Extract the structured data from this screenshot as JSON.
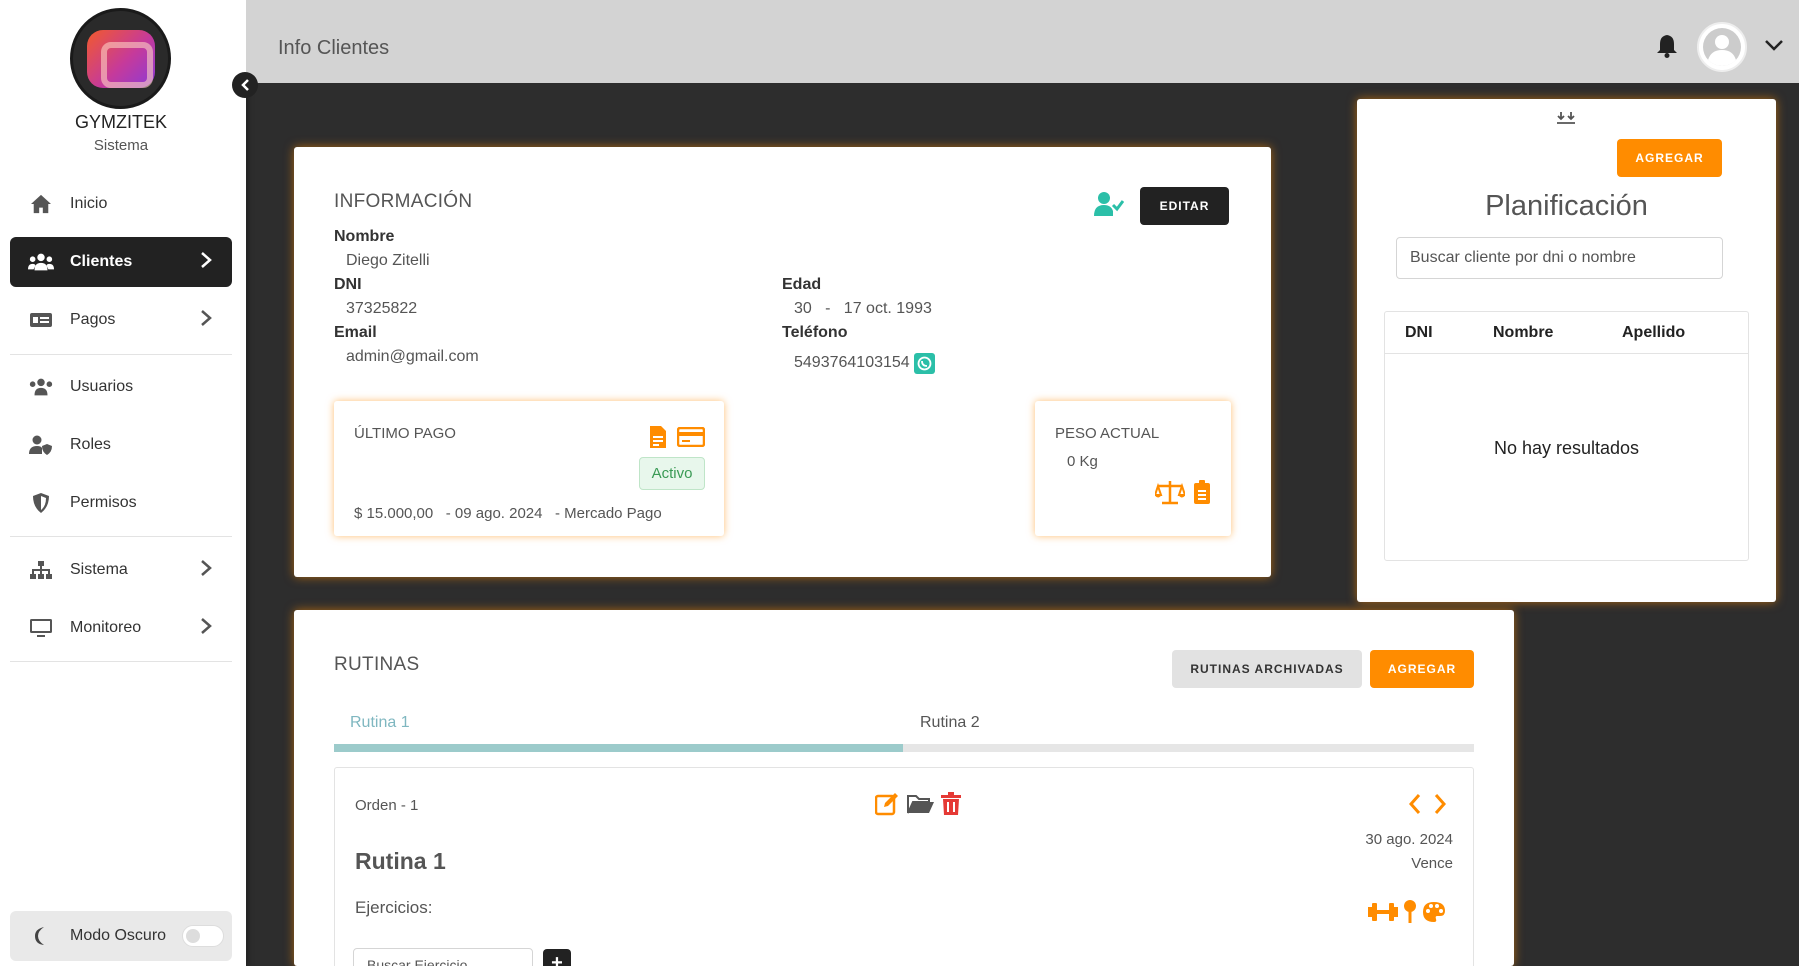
{
  "sidebar": {
    "brand_name": "GYMZITEK",
    "brand_sub": "Sistema",
    "items": [
      {
        "label": "Inicio",
        "icon": "home-icon"
      },
      {
        "label": "Clientes",
        "icon": "users-icon",
        "active": true
      },
      {
        "label": "Pagos",
        "icon": "money-icon"
      },
      {
        "label": "Usuarios",
        "icon": "users-icon"
      },
      {
        "label": "Roles",
        "icon": "user-shield-icon"
      },
      {
        "label": "Permisos",
        "icon": "shield-icon"
      },
      {
        "label": "Sistema",
        "icon": "sitemap-icon"
      },
      {
        "label": "Monitoreo",
        "icon": "monitor-icon"
      }
    ],
    "dark_mode_label": "Modo Oscuro"
  },
  "header": {
    "title": "Info Clientes"
  },
  "info": {
    "section_title": "INFORMACIÓN",
    "edit_button": "EDITAR",
    "nombre_label": "Nombre",
    "nombre_value": "Diego Zitelli",
    "dni_label": "DNI",
    "dni_value": "37325822",
    "email_label": "Email",
    "email_value": "admin@gmail.com",
    "edad_label": "Edad",
    "edad_value": "30   -   17 oct. 1993",
    "telefono_label": "Teléfono",
    "telefono_value": "5493764103154"
  },
  "ultimo_pago": {
    "title": "ÚLTIMO PAGO",
    "status": "Activo",
    "detail": "$ 15.000,00   - 09 ago. 2024   - Mercado Pago"
  },
  "peso": {
    "title": "PESO ACTUAL",
    "value": "0 Kg"
  },
  "planificacion": {
    "add_button": "AGREGAR",
    "title": "Planificación",
    "search_placeholder": "Buscar cliente por dni o nombre",
    "columns": [
      "DNI",
      "Nombre",
      "Apellido"
    ],
    "empty": "No hay resultados"
  },
  "rutinas": {
    "title": "RUTINAS",
    "archived_button": "RUTINAS ARCHIVADAS",
    "add_button": "AGREGAR",
    "tabs": [
      "Rutina 1",
      "Rutina 2"
    ],
    "selected_tab_index": 0,
    "orden": "Orden - 1",
    "routine_name": "Rutina 1",
    "date": "30 ago. 2024",
    "vence": "Vence",
    "ejercicios_label": "Ejercicios:",
    "exercise_search_placeholder": "Buscar Ejercicio"
  },
  "colors": {
    "accent": "#ff8c00",
    "dark": "#222222",
    "teal": "#2bbfa8",
    "danger": "#e53935"
  }
}
